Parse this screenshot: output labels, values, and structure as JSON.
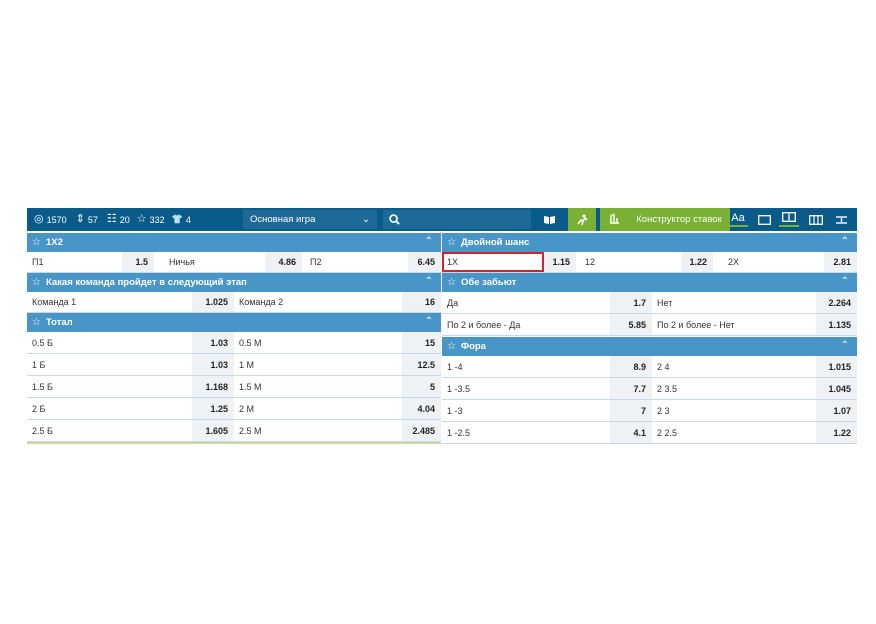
{
  "toolbar": {
    "stats": [
      {
        "icon": "target-icon",
        "glyph": "◎",
        "value": "1570"
      },
      {
        "icon": "sort-icon",
        "glyph": "⇕",
        "value": "57"
      },
      {
        "icon": "list-icon",
        "glyph": "☷",
        "value": "20"
      },
      {
        "icon": "star-icon",
        "glyph": "☆",
        "value": "332"
      },
      {
        "icon": "shirt-icon",
        "glyph": "👕",
        "value": "4"
      }
    ],
    "game_select": "Основная игра",
    "constructor_label": "Конструктор ставок",
    "font_label": "Аа"
  },
  "left": {
    "x12": {
      "title": "1X2",
      "rows": [
        [
          {
            "n": "П1",
            "o": "1.5"
          },
          {
            "n": "Ничья",
            "o": "4.86"
          },
          {
            "n": "П2",
            "o": "6.45"
          }
        ]
      ]
    },
    "next_stage": {
      "title": "Какая команда пройдет в следующий этап",
      "rows": [
        [
          {
            "n": "Команда 1",
            "o": "1.025"
          },
          {
            "n": "Команда 2",
            "o": "16"
          }
        ]
      ]
    },
    "total": {
      "title": "Тотал",
      "rows": [
        [
          {
            "n": "0.5 Б",
            "o": "1.03"
          },
          {
            "n": "0.5 М",
            "o": "15"
          }
        ],
        [
          {
            "n": "1 Б",
            "o": "1.03"
          },
          {
            "n": "1 М",
            "o": "12.5"
          }
        ],
        [
          {
            "n": "1.5 Б",
            "o": "1.168"
          },
          {
            "n": "1.5 М",
            "o": "5"
          }
        ],
        [
          {
            "n": "2 Б",
            "o": "1.25"
          },
          {
            "n": "2 М",
            "o": "4.04"
          }
        ],
        [
          {
            "n": "2.5 Б",
            "o": "1.605"
          },
          {
            "n": "2.5 М",
            "o": "2.485"
          }
        ]
      ]
    }
  },
  "right": {
    "double_chance": {
      "title": "Двойной шанс",
      "rows": [
        [
          {
            "n": "1X",
            "o": "1.15"
          },
          {
            "n": "12",
            "o": "1.22"
          },
          {
            "n": "2X",
            "o": "2.81"
          }
        ]
      ]
    },
    "both_score": {
      "title": "Обе забьют",
      "rows": [
        [
          {
            "n": "Да",
            "o": "1.7"
          },
          {
            "n": "Нет",
            "o": "2.264"
          }
        ],
        [
          {
            "n": "По 2 и более - Да",
            "o": "5.85"
          },
          {
            "n": "По 2 и более - Нет",
            "o": "1.135"
          }
        ]
      ]
    },
    "handicap": {
      "title": "Фора",
      "rows": [
        [
          {
            "n": "1 -4",
            "o": "8.9"
          },
          {
            "n": "2 4",
            "o": "1.015"
          }
        ],
        [
          {
            "n": "1 -3.5",
            "o": "7.7"
          },
          {
            "n": "2 3.5",
            "o": "1.045"
          }
        ],
        [
          {
            "n": "1 -3",
            "o": "7"
          },
          {
            "n": "2 3",
            "o": "1.07"
          }
        ],
        [
          {
            "n": "1 -2.5",
            "o": "4.1"
          },
          {
            "n": "2 2.5",
            "o": "1.22"
          }
        ]
      ]
    }
  },
  "colors": {
    "header": "#4896c8",
    "toolbar": "#0b5b8a",
    "accent_green": "#7ab135",
    "highlight": "#d0232a"
  }
}
